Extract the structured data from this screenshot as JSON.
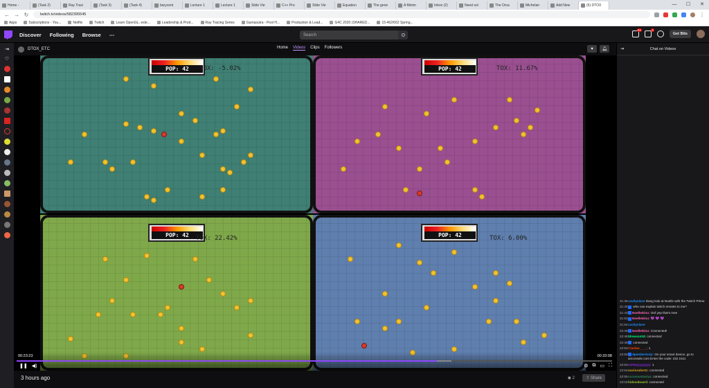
{
  "browser": {
    "tabs": [
      {
        "label": "Home - ",
        "active": false
      },
      {
        "label": "(Task 2) ",
        "active": false
      },
      {
        "label": "Ray Traci",
        "active": false
      },
      {
        "label": "(Task 3) ",
        "active": false
      },
      {
        "label": "(Task 4) ",
        "active": false
      },
      {
        "label": "barycent",
        "active": false
      },
      {
        "label": "Lecture 1",
        "active": false
      },
      {
        "label": "Lecture 1",
        "active": false
      },
      {
        "label": "Slide Vie",
        "active": false
      },
      {
        "label": "C++ Pro",
        "active": false
      },
      {
        "label": "Slide Vie",
        "active": false
      },
      {
        "label": "Equation",
        "active": false
      },
      {
        "label": "The gene",
        "active": false
      },
      {
        "label": "A Minim",
        "active": false
      },
      {
        "label": "Inbox (2)",
        "active": false
      },
      {
        "label": "Need sol",
        "active": false
      },
      {
        "label": "The Orca",
        "active": false
      },
      {
        "label": "Michelan",
        "active": false
      },
      {
        "label": "Add New",
        "active": false
      },
      {
        "label": "(6) DTOX",
        "active": true
      }
    ],
    "window_controls": [
      "—",
      "☐",
      "✕"
    ],
    "url": "twitch.tv/videos/582395545",
    "bookmarks": [
      "Apps",
      "Subscriptions - You...",
      "Netflix",
      "Twitch",
      "Learn OpenGL, exte...",
      "Leadership & Prod...",
      "Ray Tracing Series",
      "Gamasutra - Pool H...",
      "Production & Lead...",
      "G4C 2020 (SHARED...",
      "15-462/662 Spring..."
    ]
  },
  "topnav": {
    "links": [
      "Discover",
      "Following",
      "Browse"
    ],
    "more": "⋯",
    "search_placeholder": "Search",
    "notif_count": "94",
    "whisper_count": "6",
    "get_bits": "Get Bits"
  },
  "channel": {
    "name": "DTOX_ETC",
    "tabs": [
      "Home",
      "Videos",
      "Clips",
      "Followers"
    ],
    "active_tab": "Videos"
  },
  "video": {
    "panels": [
      {
        "pop": "POP: 42",
        "tox": "TOX: -5.02%",
        "color": "#3f7f74"
      },
      {
        "pop": "POP: 42",
        "tox": "TOX: 11.67%",
        "color": "#9a4f90"
      },
      {
        "pop": "POP: 42",
        "tox": "TOX: 22.42%",
        "color": "#7fa84a"
      },
      {
        "pop": "POP: 42",
        "tox": "TOX: 6.00%",
        "color": "#5f7fae"
      }
    ],
    "time_elapsed": "00:23:23",
    "time_total": "00:33:08",
    "progress": 0.706,
    "buffered": 0.73
  },
  "below": {
    "ago": "3 hours ago",
    "views": "2",
    "share": "Share"
  },
  "chat": {
    "title": "Chat on Videos",
    "messages": [
      {
        "t": "21:35",
        "user": "cavityslave",
        "color": "#1e90ff",
        "text": "Dang look at Noelle with the Twitch Prime",
        "badge": false
      },
      {
        "t": "21:40",
        "user": "",
        "color": "#1e90ff",
        "text": "who can explain twitch emotes to me?",
        "badge": true
      },
      {
        "t": "21:43",
        "user": "NoelleDinu:",
        "color": "#ff69b4",
        "text": "Oof yep that's mee",
        "badge": true
      },
      {
        "t": "21:53",
        "user": "NoelleDinu:",
        "color": "#ff69b4",
        "text": "💜 💜 💜",
        "badge": true
      },
      {
        "t": "21:54",
        "user": "cavityslave",
        "color": "#1e90ff",
        "text": "",
        "badge": false
      },
      {
        "t": "22:45",
        "user": "NoelleDinu:",
        "color": "#ff69b4",
        "text": "Connected!",
        "badge": true
      },
      {
        "t": "22:48",
        "user": "tdreason18:",
        "color": "#00ff7f",
        "text": "connected",
        "badge": false
      },
      {
        "t": "22:49",
        "user": "",
        "color": "#1e90ff",
        "text": "connected",
        "badge": true
      },
      {
        "t": "22:50",
        "user": "Ciardas____:",
        "color": "#ff4500",
        "text": "1",
        "badge": false
      },
      {
        "t": "22:50",
        "user": "dpembertonjr:",
        "color": "#1e90ff",
        "text": "On your smart device, go to airconsole.com Enter the code: 232 1511",
        "badge": true
      },
      {
        "t": "22:53",
        "user": "ashleyyyyyyyy:",
        "color": "#8a2be2",
        "text": "1",
        "badge": false
      },
      {
        "t": "22:54",
        "user": "marissahertz:",
        "color": "#daa520",
        "text": "connected",
        "badge": false
      },
      {
        "t": "22:55",
        "user": "cocomuntasiya:",
        "color": "#2e8b57",
        "text": "connected",
        "badge": false
      },
      {
        "t": "23:04",
        "user": "hidsonboard:",
        "color": "#9acd32",
        "text": "connected",
        "badge": false
      }
    ]
  }
}
